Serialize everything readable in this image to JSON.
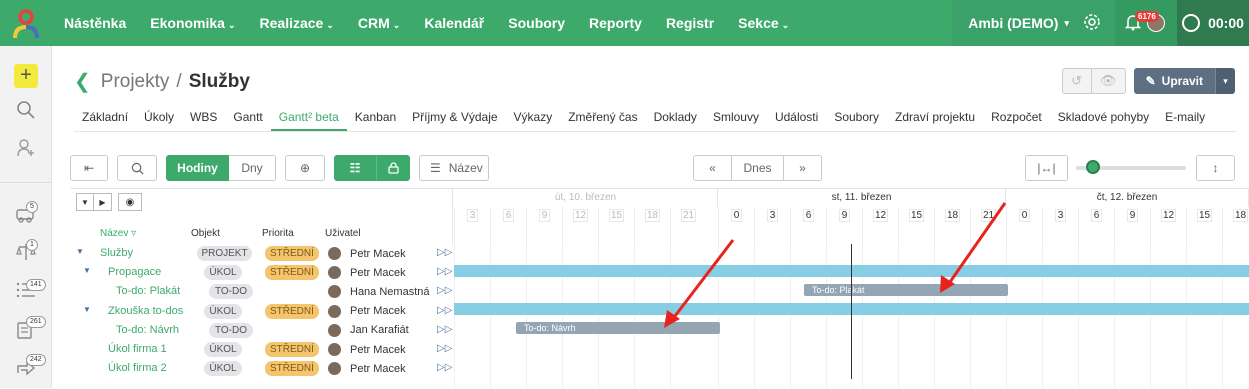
{
  "topbar": {
    "nav": [
      {
        "label": "Nástěnka",
        "dropdown": false
      },
      {
        "label": "Ekonomika",
        "dropdown": true
      },
      {
        "label": "Realizace",
        "dropdown": true
      },
      {
        "label": "CRM",
        "dropdown": true
      },
      {
        "label": "Kalendář",
        "dropdown": false
      },
      {
        "label": "Soubory",
        "dropdown": false
      },
      {
        "label": "Reporty",
        "dropdown": false
      },
      {
        "label": "Registr",
        "dropdown": false
      },
      {
        "label": "Sekce",
        "dropdown": true
      }
    ],
    "account": "Ambi (DEMO)",
    "notifications": "6176",
    "timer": "00:00"
  },
  "sidebar": {
    "counts": {
      "a": "5",
      "b": "1",
      "c": "141",
      "d": "261",
      "e": "242"
    }
  },
  "header": {
    "crumb": "Projekty",
    "sep": "/",
    "current": "Služby",
    "edit_label": "Upravit"
  },
  "tabs": [
    "Základní",
    "Úkoly",
    "WBS",
    "Gantt",
    "Gantt² beta",
    "Kanban",
    "Příjmy & Výdaje",
    "Výkazy",
    "Změřený čas",
    "Doklady",
    "Smlouvy",
    "Události",
    "Soubory",
    "Zdraví projektu",
    "Rozpočet",
    "Skladové pohyby",
    "E-maily"
  ],
  "active_tab": 4,
  "toolbar": {
    "hours": "Hodiny",
    "days": "Dny",
    "name": "Název",
    "today": "Dnes"
  },
  "columns": {
    "name": "Název",
    "object": "Objekt",
    "priority": "Priorita",
    "user": "Uživatel"
  },
  "rows": [
    {
      "name": "Služby",
      "type": "PROJEKT",
      "priority": "STŘEDNÍ",
      "user": "Petr Macek",
      "level": 0,
      "toggle": true
    },
    {
      "name": "Propagace",
      "type": "ÚKOL",
      "priority": "STŘEDNÍ",
      "user": "Petr Macek",
      "level": 1,
      "toggle": true
    },
    {
      "name": "To-do: Plakát",
      "type": "TO-DO",
      "priority": "",
      "user": "Hana Nemastná",
      "level": 2,
      "toggle": false
    },
    {
      "name": "Zkouška to-dos",
      "type": "ÚKOL",
      "priority": "STŘEDNÍ",
      "user": "Petr Macek",
      "level": 1,
      "toggle": true
    },
    {
      "name": "To-do: Návrh",
      "type": "TO-DO",
      "priority": "",
      "user": "Jan Karafiát",
      "level": 2,
      "toggle": false
    },
    {
      "name": "Úkol firma 1",
      "type": "ÚKOL",
      "priority": "STŘEDNÍ",
      "user": "Petr Macek",
      "level": 1,
      "toggle": false
    },
    {
      "name": "Úkol firma 2",
      "type": "ÚKOL",
      "priority": "STŘEDNÍ",
      "user": "Petr Macek",
      "level": 1,
      "toggle": false
    }
  ],
  "timeline": {
    "days": [
      "út, 10. březen",
      "st, 11. březen",
      "čt, 12. březen"
    ],
    "hours_day1": [
      "3",
      "6",
      "9",
      "12",
      "15",
      "18",
      "21"
    ],
    "hours_day2": [
      "0",
      "3",
      "6",
      "9",
      "12",
      "15",
      "18",
      "21"
    ],
    "hours_day3": [
      "0",
      "3",
      "6",
      "9",
      "12",
      "15",
      "18"
    ],
    "bars": {
      "plakat": "To-do: Plakát",
      "navrh": "To-do: Návrh"
    }
  },
  "colors": {
    "brand": "#3daa6c",
    "bar_blue": "#87cde4",
    "bar_grey": "#94a6b3",
    "arrow": "#e8231f",
    "priority": "#f5c56d"
  }
}
